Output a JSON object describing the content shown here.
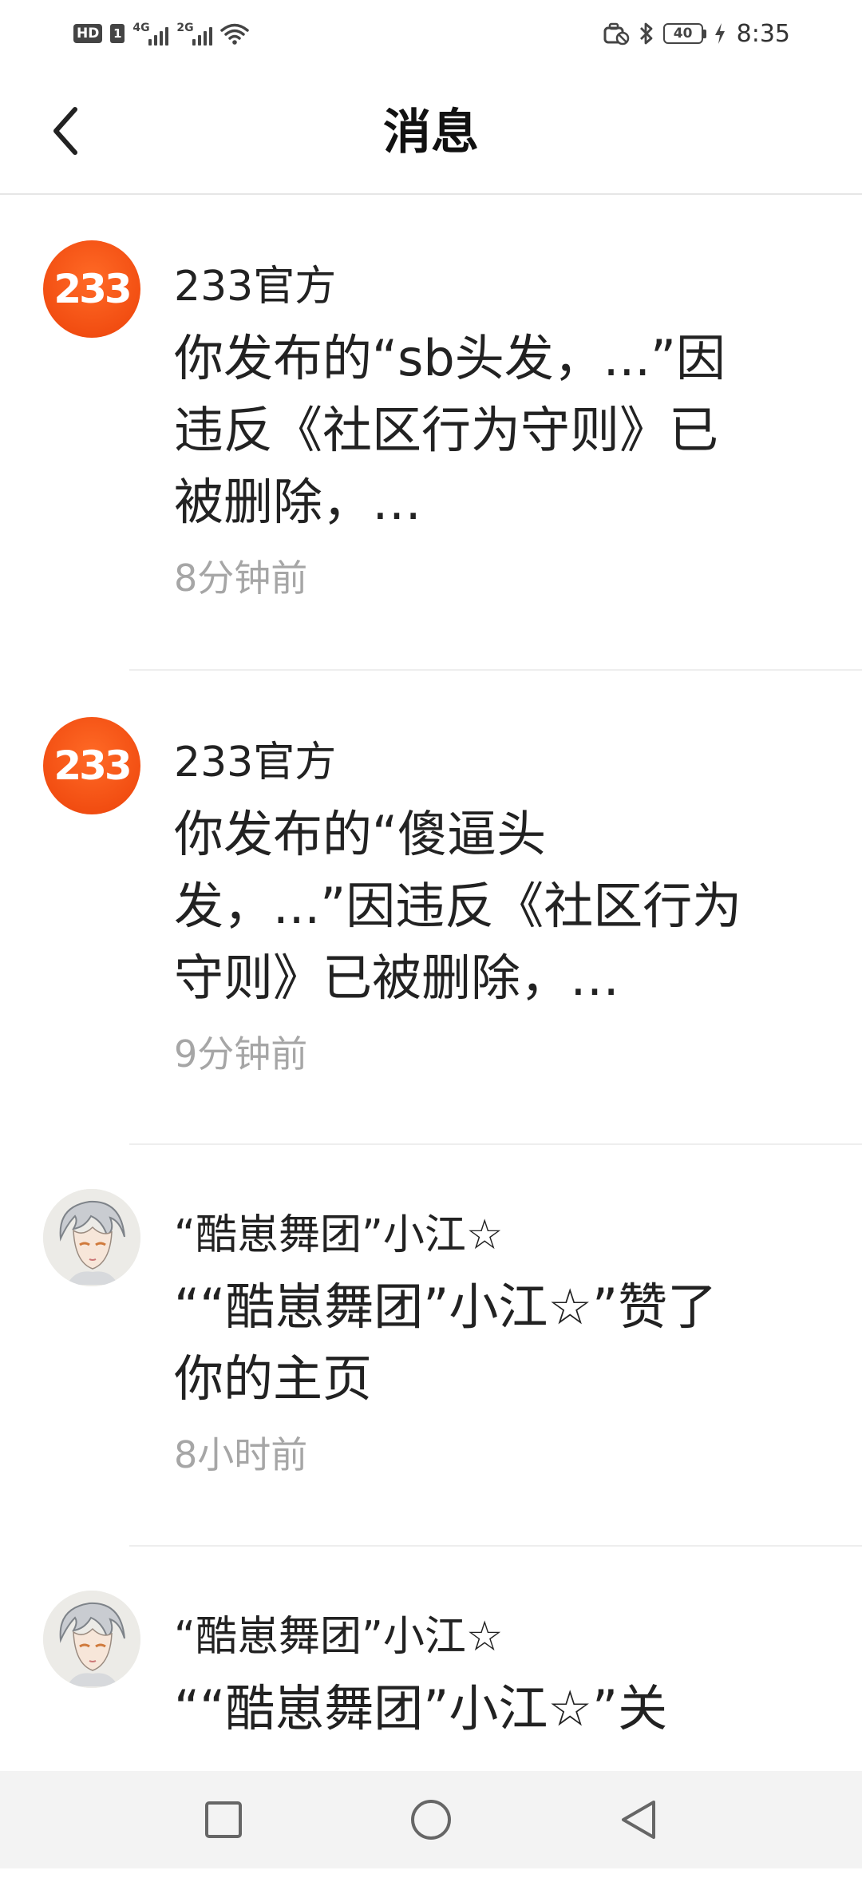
{
  "status_bar": {
    "hd_label": "HD",
    "sim_label": "1",
    "net1": "4G",
    "net2": "2G",
    "battery": "40",
    "time": "8:35"
  },
  "header": {
    "title": "消息"
  },
  "messages": [
    {
      "avatar_type": "official",
      "avatar_text": "233",
      "sender": "233官方",
      "text": "你发布的“sb头发，...”因违反《社区行为守则》已被删除，…",
      "time": "8分钟前"
    },
    {
      "avatar_type": "official",
      "avatar_text": "233",
      "sender": "233官方",
      "text": "你发布的“傻逼头发，...”因违反《社区行为守则》已被删除，…",
      "time": "9分钟前"
    },
    {
      "avatar_type": "user",
      "sender": "“酷崽舞团”小江☆",
      "text": "““酷崽舞团”小江☆”赞了你的主页",
      "time": "8小时前"
    },
    {
      "avatar_type": "user",
      "sender": "“酷崽舞团”小江☆",
      "text": "““酷崽舞团”小江☆”关",
      "time": ""
    }
  ],
  "colors": {
    "official_avatar": "#f24e12",
    "time_text": "#a6a6a6",
    "nav_background": "#f3f3f3"
  }
}
